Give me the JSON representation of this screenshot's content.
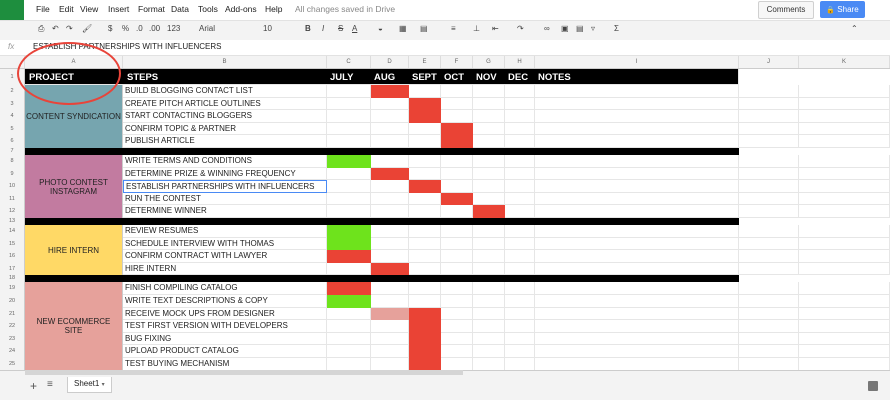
{
  "menu": {
    "items": [
      "File",
      "Edit",
      "View",
      "Insert",
      "Format",
      "Data",
      "Tools",
      "Add-ons",
      "Help"
    ],
    "saved_status": "All changes saved in Drive"
  },
  "header_buttons": {
    "comments": "Comments",
    "share": "Share"
  },
  "toolbar": {
    "currency": "$",
    "percent": "%",
    "decimal_less": ".0",
    "decimal_more": ".00",
    "more_formats": "123",
    "font": "Arial",
    "font_size": "10",
    "bold": "B",
    "italic": "I",
    "strike": "S",
    "text_color": "A",
    "function": "Σ"
  },
  "formula_bar": {
    "fx": "fx",
    "content": "ESTABLISH PARTNERSHIPS WITH INFLUENCERS"
  },
  "column_headers": [
    "A",
    "B",
    "C",
    "D",
    "E",
    "F",
    "G",
    "H",
    "I",
    "J",
    "K"
  ],
  "sheet_header": {
    "project": "PROJECT",
    "steps": "STEPS",
    "months": [
      "JULY",
      "AUG",
      "SEPT",
      "OCT",
      "NOV",
      "DEC"
    ],
    "notes": "NOTES"
  },
  "row_numbers": [
    "1",
    "2",
    "3",
    "4",
    "5",
    "6",
    "7",
    "8",
    "9",
    "10",
    "11",
    "12",
    "13",
    "14",
    "15",
    "16",
    "17",
    "18",
    "19",
    "20",
    "21",
    "22",
    "23",
    "24",
    "25"
  ],
  "projects": [
    {
      "name": "CONTENT SYNDICATION",
      "color": "#76a5af"
    },
    {
      "name": "PHOTO CONTEST\nINSTAGRAM",
      "color": "#c27ba0"
    },
    {
      "name": "HIRE INTERN",
      "color": "#ffd966"
    },
    {
      "name": "NEW ECOMMERCE\nSITE",
      "color": "#e6a19b"
    }
  ],
  "steps": [
    {
      "label": "BUILD BLOGGING CONTACT LIST",
      "bar": {
        "month": 1,
        "color": "#ea4335"
      }
    },
    {
      "label": "CREATE PITCH ARTICLE OUTLINES",
      "bar": {
        "month": 2,
        "color": "#ea4335"
      }
    },
    {
      "label": "START CONTACTING BLOGGERS",
      "bar": {
        "month": 2,
        "color": "#ea4335"
      }
    },
    {
      "label": "CONFIRM TOPIC & PARTNER",
      "bar": {
        "month": 3,
        "color": "#ea4335"
      }
    },
    {
      "label": "PUBLISH ARTICLE",
      "bar": {
        "month": 3,
        "color": "#ea4335"
      }
    },
    {
      "label": "WRITE TERMS AND CONDITIONS",
      "bar": {
        "month": 0,
        "color": "#6ee31c"
      }
    },
    {
      "label": "DETERMINE PRIZE & WINNING FREQUENCY",
      "bar": {
        "month": 1,
        "color": "#ea4335"
      }
    },
    {
      "label": "ESTABLISH PARTNERSHIPS WITH INFLUENCERS",
      "bar": {
        "month": 2,
        "color": "#ea4335"
      }
    },
    {
      "label": "RUN THE CONTEST",
      "bar": {
        "month": 3,
        "color": "#ea4335"
      }
    },
    {
      "label": "DETERMINE WINNER",
      "bar": {
        "month": 4,
        "color": "#ea4335"
      }
    },
    {
      "label": "REVIEW RESUMES",
      "bar": {
        "month": 0,
        "color": "#6ee31c"
      }
    },
    {
      "label": "SCHEDULE INTERVIEW WITH THOMAS",
      "bar": {
        "month": 0,
        "color": "#6ee31c"
      }
    },
    {
      "label": "CONFIRM CONTRACT WITH LAWYER",
      "bar": {
        "month": 0,
        "color": "#ea4335"
      }
    },
    {
      "label": "HIRE INTERN",
      "bar": {
        "month": 1,
        "color": "#ea4335"
      }
    },
    {
      "label": "FINISH COMPILING CATALOG",
      "bar": {
        "month": 0,
        "color": "#ea4335"
      }
    },
    {
      "label": "WRITE TEXT DESCRIPTIONS & COPY",
      "bar": {
        "month": 0,
        "color": "#6ee31c"
      }
    },
    {
      "label": "RECEIVE MOCK UPS FROM DESIGNER",
      "bar": {
        "month": 1,
        "color": "#e6a19b"
      },
      "bar2": {
        "month": 2,
        "color": "#ea4335"
      }
    },
    {
      "label": "TEST FIRST VERSION WITH DEVELOPERS",
      "bar": {
        "month": 2,
        "color": "#ea4335"
      }
    },
    {
      "label": "BUG FIXING",
      "bar": {
        "month": 2,
        "color": "#ea4335"
      }
    },
    {
      "label": "UPLOAD PRODUCT CATALOG",
      "bar": {
        "month": 2,
        "color": "#ea4335"
      }
    },
    {
      "label": "TEST BUYING MECHANISM",
      "bar": {
        "month": 2,
        "color": "#ea4335"
      }
    }
  ],
  "sheet_tabs": {
    "active": "Sheet1"
  }
}
